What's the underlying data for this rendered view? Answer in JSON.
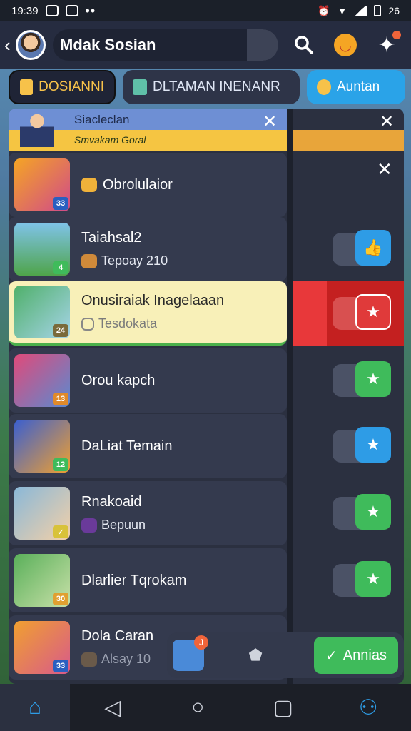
{
  "status_bar": {
    "time": "19:39",
    "battery": "26"
  },
  "header": {
    "back_icon": "chevron-left-icon",
    "title": "Mdak Sosian",
    "icons": [
      "search-icon",
      "emoji-icon",
      "notification-icon"
    ]
  },
  "tabs": [
    {
      "label": "DOSIANNI",
      "icon": "folder-icon",
      "active": true
    },
    {
      "label": "DLTAMAN INENANR",
      "icon": "map-icon",
      "active": false
    },
    {
      "label": "Auntan",
      "icon": "duck-icon",
      "active": false
    }
  ],
  "banner": {
    "title": "Siacleclan",
    "subtitle": "Smvakam Goral"
  },
  "rows": [
    {
      "name": "Obrolulaior",
      "sub": "",
      "badge": "33",
      "toggle": "none",
      "highlight": false
    },
    {
      "name": "Taiahsal2",
      "sub": "Tepoay 210",
      "badge": "4",
      "toggle": "blue",
      "highlight": false
    },
    {
      "name": "Onusiraiak Inagelaaan",
      "sub": "Tesdokata",
      "badge": "24",
      "toggle": "red",
      "highlight": true
    },
    {
      "name": "Orou kapch",
      "sub": "",
      "badge": "13",
      "toggle": "green",
      "highlight": false
    },
    {
      "name": "DaLiat Temain",
      "sub": "",
      "badge": "12",
      "toggle": "blue",
      "highlight": false
    },
    {
      "name": "Rnakoaid",
      "sub": "Bepuun",
      "badge": "",
      "toggle": "green",
      "highlight": false
    },
    {
      "name": "Dlarlier Tqrokam",
      "sub": "",
      "badge": "30",
      "toggle": "green",
      "highlight": false
    },
    {
      "name": "Dola Caran",
      "sub": "Alsay 10",
      "badge": "33",
      "toggle": "none",
      "highlight": false
    }
  ],
  "float_bar": {
    "badge": "J",
    "button_label": "Annias"
  },
  "nav": [
    "home-icon",
    "back-icon",
    "circle-home-icon",
    "square-recents-icon",
    "profile-icon"
  ],
  "colors": {
    "accent_blue": "#2e9ce6",
    "accent_green": "#3fbb5b",
    "accent_red": "#e03a3a",
    "highlight": "#f8f0b8"
  }
}
